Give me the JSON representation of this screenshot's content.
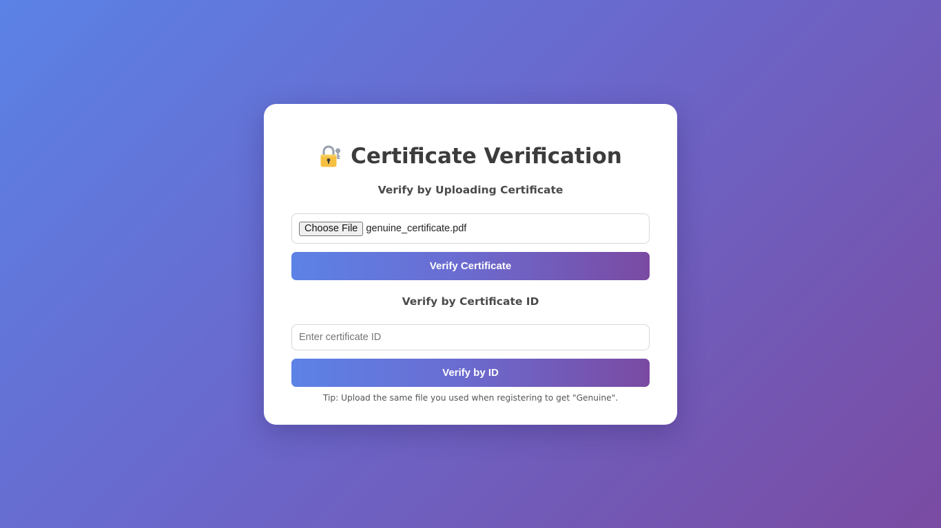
{
  "page": {
    "title": "Certificate Verification",
    "title_icon": "locked-with-key-icon"
  },
  "upload_section": {
    "heading": "Verify by Uploading Certificate",
    "choose_file_label": "Choose File",
    "selected_file": "genuine_certificate.pdf",
    "submit_label": "Verify Certificate"
  },
  "id_section": {
    "heading": "Verify by Certificate ID",
    "input_value": "",
    "input_placeholder": "Enter certificate ID",
    "submit_label": "Verify by ID"
  },
  "tip": "Tip: Upload the same file you used when registering to get \"Genuine\".",
  "colors": {
    "gradient_start": "#5b82e6",
    "gradient_end": "#7a4ba2",
    "card_bg": "#ffffff",
    "title_text": "#3c3c3c"
  }
}
